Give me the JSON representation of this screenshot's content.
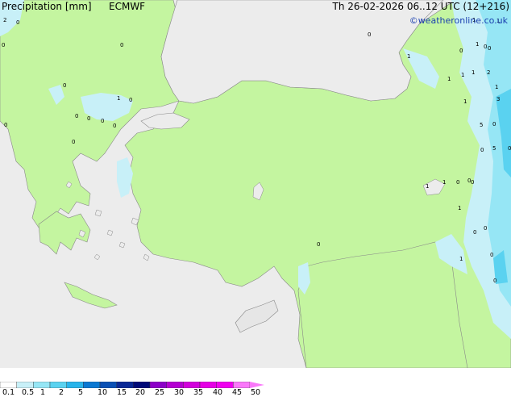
{
  "footer": {
    "title": "Precipitation [mm]",
    "model": "ECMWF",
    "valid": "Th 26-02-2026 06..12 UTC (12+216)",
    "copyright": "©weatheronline.co.uk"
  },
  "legend": {
    "labels": [
      "0.1",
      "0.5",
      "1",
      "2",
      "5",
      "10",
      "15",
      "20",
      "25",
      "30",
      "35",
      "40",
      "45",
      "50"
    ],
    "colors": [
      "#ffffff",
      "#c8f0f8",
      "#96e6f5",
      "#5ad2f0",
      "#28b4eb",
      "#0a78d2",
      "#0a50b4",
      "#0a2896",
      "#000a78",
      "#8c00c8",
      "#b400d2",
      "#d200dc",
      "#e600e6",
      "#f000f0",
      "#fa78fa"
    ]
  },
  "map": {
    "colors": {
      "sea": "#ececec",
      "land_no_precip": "#e6e6e6",
      "precip_light": "#c4f5a0",
      "precip_01": "#c8f0f8",
      "precip_05": "#96e6f5",
      "precip_2": "#5ad2f0",
      "coast": "#888888"
    },
    "values": [
      "2",
      "0",
      "0",
      "0",
      "0",
      "0",
      "1",
      "0",
      "0",
      "0",
      "0",
      "0",
      "0",
      "0",
      "1",
      "0",
      "1",
      "0",
      "1",
      "1",
      "0",
      "1",
      "2",
      "1",
      "1",
      "1",
      "1",
      "3",
      "0",
      "5",
      "5",
      "0",
      "0",
      "1",
      "0",
      "0",
      "1",
      "0",
      "1",
      "0",
      "0",
      "1",
      "0",
      "0",
      "0"
    ]
  }
}
